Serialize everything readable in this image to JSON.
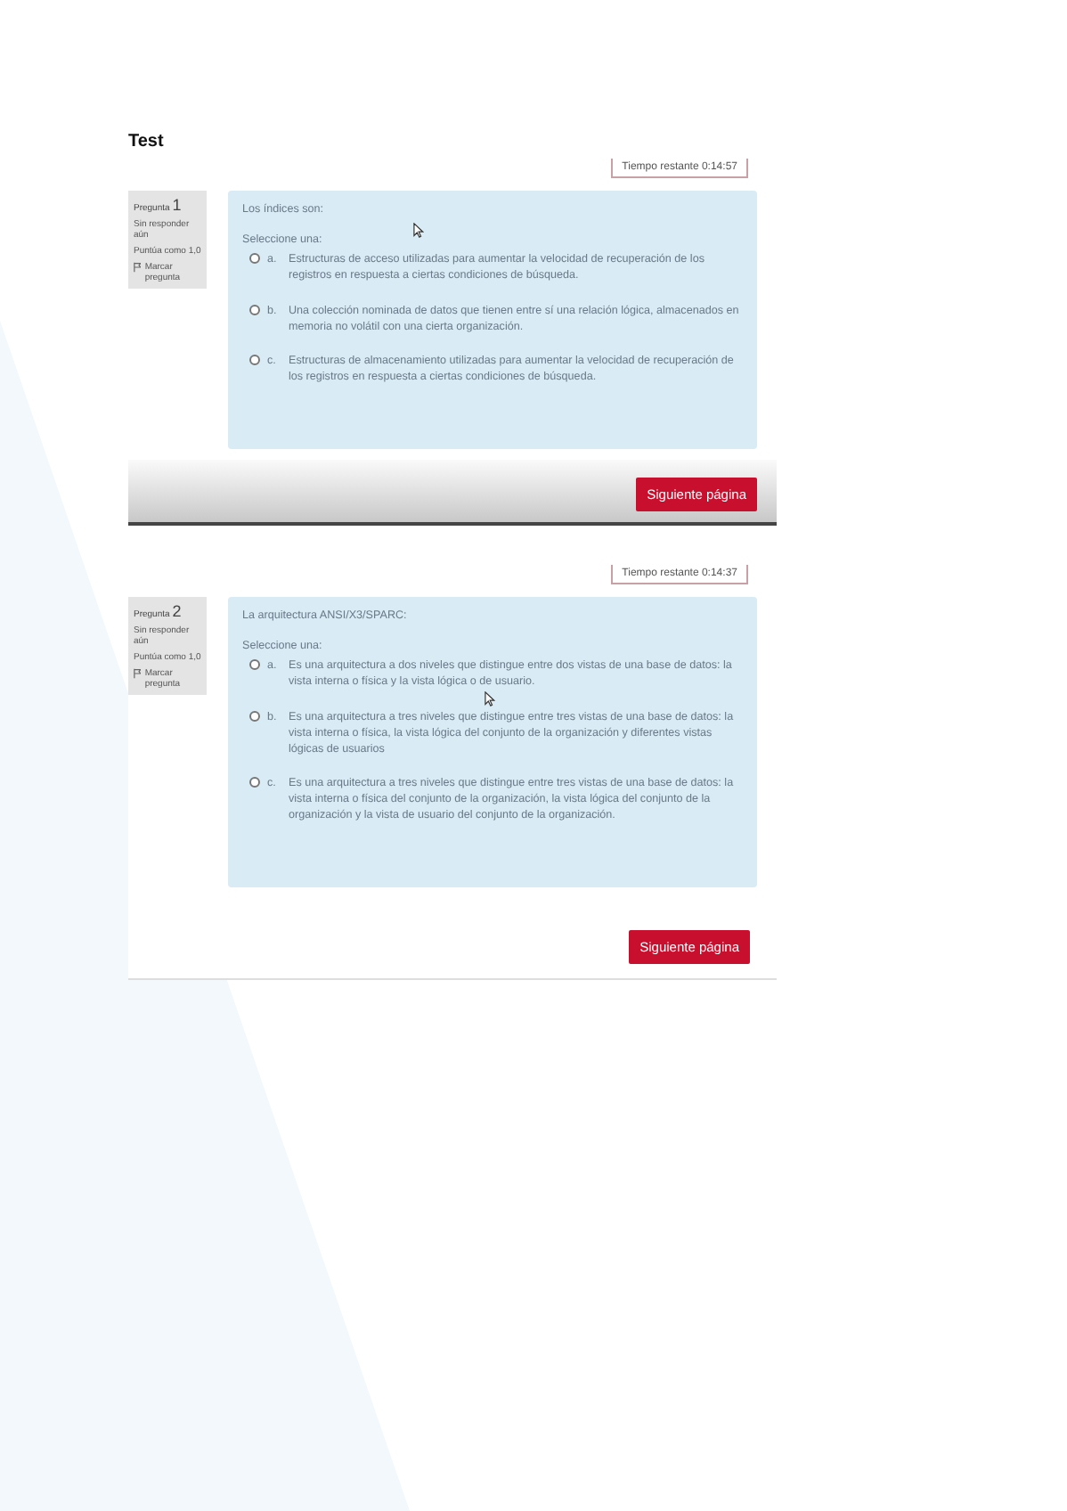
{
  "title": "Test",
  "screenshots": [
    {
      "timer": "Tiempo restante 0:14:57",
      "question_label": "Pregunta",
      "question_number": "1",
      "status": "Sin responder aún",
      "score": "Puntúa como 1,0",
      "flag_label": "Marcar pregunta",
      "question": "Los índices son:",
      "prompt": "Seleccione una:",
      "footer": {
        "kind": "shaded",
        "button": "Siguiente página"
      },
      "options": [
        {
          "letter": "a.",
          "text": "Estructuras de acceso utilizadas para aumentar la velocidad de recuperación de los registros en respuesta a ciertas condiciones de búsqueda.",
          "selected": false
        },
        {
          "letter": "b.",
          "text": "Una colección nominada de datos que tienen entre sí una relación lógica, almacenados en memoria no volátil con una cierta organización.",
          "selected": false
        },
        {
          "letter": "c.",
          "text": "Estructuras de almacenamiento utilizadas para aumentar la velocidad de recuperación de los registros en respuesta a ciertas condiciones de búsqueda.",
          "selected": false
        }
      ]
    },
    {
      "timer": "Tiempo restante 0:14:37",
      "question_label": "Pregunta",
      "question_number": "2",
      "status": "Sin responder aún",
      "score": "Puntúa como 1,0",
      "flag_label": "Marcar pregunta",
      "question": "La arquitectura ANSI/X3/SPARC:",
      "prompt": "Seleccione una:",
      "footer": {
        "kind": "plain",
        "button": "Siguiente página"
      },
      "options": [
        {
          "letter": "a.",
          "text": "Es una arquitectura a dos niveles que distingue entre dos vistas de una base de datos: la vista interna o física y la vista lógica o de usuario.",
          "selected": false
        },
        {
          "letter": "b.",
          "text": "Es una arquitectura a tres niveles que distingue entre tres vistas de una base de datos: la vista interna o física, la vista lógica del conjunto de la organización y diferentes vistas lógicas de usuarios",
          "selected": false
        },
        {
          "letter": "c.",
          "text": "Es una arquitectura a tres niveles que distingue entre tres vistas de una base de datos: la vista interna o física del conjunto de la organización, la vista lógica del conjunto de la organización y la vista de usuario del conjunto de la organización.",
          "selected": false
        }
      ]
    }
  ]
}
